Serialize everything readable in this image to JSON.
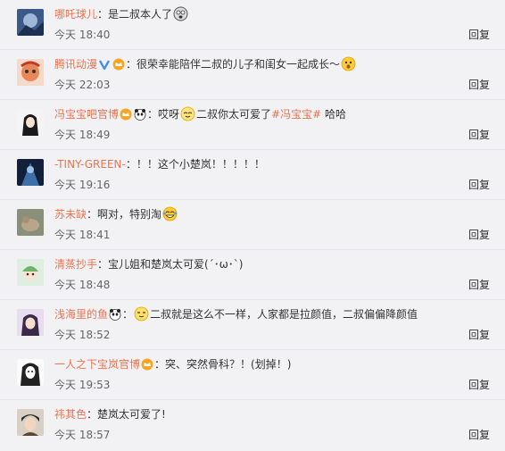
{
  "comments": [
    {
      "user": "哪吒球儿",
      "text": "是二叔本人了",
      "time_label": "今天",
      "time": "18:40",
      "reply": "回复"
    },
    {
      "user": "腾讯动漫",
      "text": "很荣幸能陪伴二叔的儿子和闺女一起成长～",
      "time_label": "今天",
      "time": "22:03",
      "reply": "回复"
    },
    {
      "user": "冯宝宝吧官博",
      "text_before": "哎呀",
      "text_after": "二叔你太可爱了",
      "tag": "#冯宝宝#",
      "text_end": " 哈哈",
      "time_label": "今天",
      "time": "18:49",
      "reply": "回复"
    },
    {
      "user": "-TINY-GREEN-",
      "text": "！！这个小楚岚！！！！！",
      "time_label": "今天",
      "time": "19:16",
      "reply": "回复"
    },
    {
      "user": "苏未缺",
      "text": "啊对，特别淘",
      "time_label": "今天",
      "time": "18:41",
      "reply": "回复"
    },
    {
      "user": "清蒸抄手",
      "text": "宝儿姐和楚岚太可爱(´･ω･`)",
      "time_label": "今天",
      "time": "18:48",
      "reply": "回复"
    },
    {
      "user": "浅海里的鱼",
      "text": "二叔就是这么不一样，人家都是拉颜值，二叔偏偏降颜值",
      "time_label": "今天",
      "time": "18:52",
      "reply": "回复"
    },
    {
      "user": "一人之下宝岚官博",
      "text": "突、突然骨科？！(划掉！)",
      "time_label": "今天",
      "time": "19:53",
      "reply": "回复"
    },
    {
      "user": "祎其色",
      "text": "楚岚太可爱了!",
      "time_label": "今天",
      "time": "18:57",
      "reply": "回复"
    }
  ],
  "colon": "：",
  "colors": {
    "username": "#eb7350",
    "background": "#f2f2f5"
  },
  "icons": [
    "avatar",
    "verified-badge-icon",
    "vip-crown-icon",
    "panda-badge-icon",
    "emoji-icon"
  ]
}
